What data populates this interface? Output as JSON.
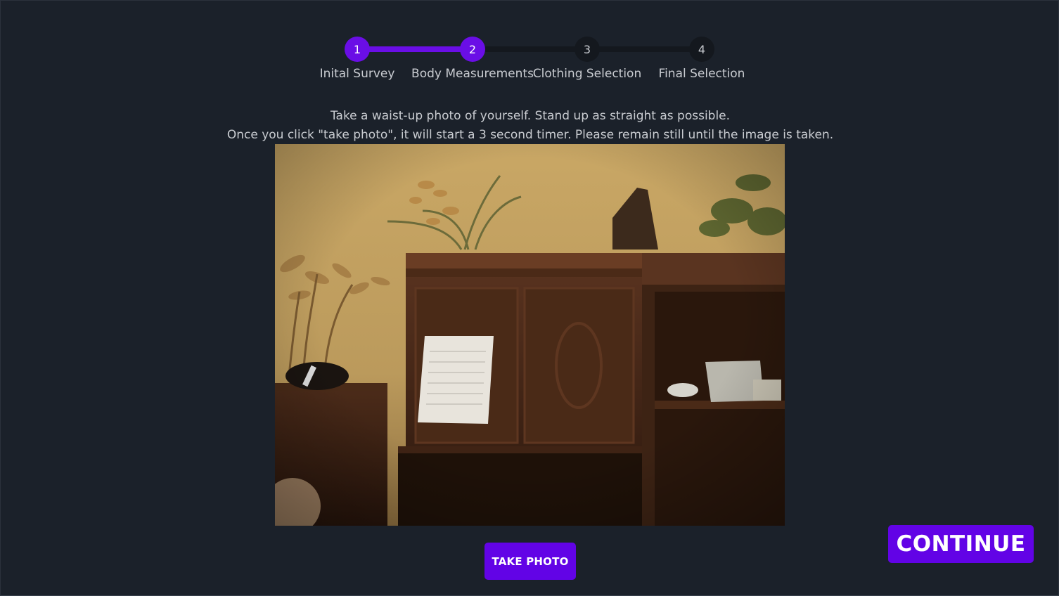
{
  "stepper": {
    "current_step": 2,
    "steps": [
      {
        "number": "1",
        "label": "Inital Survey"
      },
      {
        "number": "2",
        "label": "Body Measurements"
      },
      {
        "number": "3",
        "label": "Clothing Selection"
      },
      {
        "number": "4",
        "label": "Final Selection"
      }
    ]
  },
  "instructions": {
    "line1": "Take a waist-up photo of yourself. Stand up as straight as possible.",
    "line2": "Once you click \"take photo\", it will start a 3 second timer. Please remain still until the image is taken."
  },
  "camera": {
    "content": "live-webcam-feed"
  },
  "buttons": {
    "take_photo_label": "TAKE PHOTO",
    "continue_label": "CONTINUE"
  },
  "colors": {
    "background": "#1b212a",
    "accent": "#6203e6",
    "step_active": "#6a0ee6",
    "step_inactive": "#14181e",
    "text": "#c9ccd1"
  }
}
